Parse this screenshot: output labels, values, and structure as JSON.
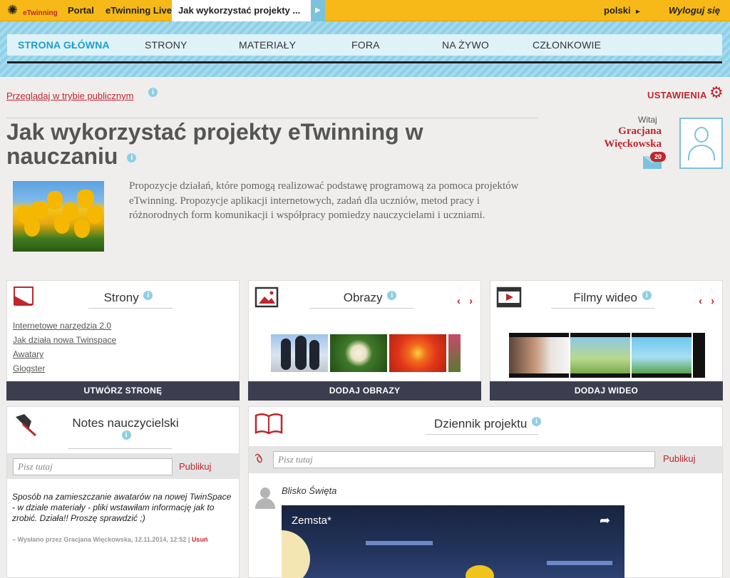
{
  "topbar": {
    "logo_text": "eTwinning",
    "nav": [
      "Portal",
      "eTwinning Live"
    ],
    "active_tab": "Jak wykorzystać projekty ...",
    "language": "polski",
    "language_arrow": "▸",
    "logout": "Wyloguj się"
  },
  "mainnav": {
    "items": [
      "STRONA GŁÓWNA",
      "STRONY",
      "MATERIAŁY",
      "FORA",
      "NA ŻYWO",
      "CZŁONKOWIE"
    ]
  },
  "header": {
    "browse_public": "Przeglądaj w trybie publicznym",
    "settings": "USTAWIENIA",
    "title": "Jak wykorzystać projekty eTwinning w nauczaniu",
    "description": "Propozycje działań, które pomogą realizować podstawę programową za pomoca projektów eTwinning. Propozycje aplikacji internetowych, zadań dla uczniów, metod pracy i różnorodnych form komunikacji i współpracy pomiedzy nauczycielami i uczniami."
  },
  "user": {
    "welcome": "Witaj",
    "name": "Gracjana Więckowska",
    "messages": "20"
  },
  "cards": {
    "pages": {
      "title": "Strony",
      "links": [
        "Internetowe narzędzia 2.0",
        "Jak działa nowa Twinspace",
        "Awatary",
        "Glogster"
      ],
      "button": "UTWÓRZ STRONĘ"
    },
    "images": {
      "title": "Obrazy",
      "button": "DODAJ OBRAZY"
    },
    "videos": {
      "title": "Filmy wideo",
      "button": "DODAJ WIDEO"
    },
    "notes": {
      "title": "Notes nauczycielski",
      "placeholder": "Pisz tutaj",
      "publish": "Publikuj",
      "post_text": "Sposób na zamieszczanie awatarów na nowej TwinSpace - w dziale materiały - pliki wstawiłam informację jak to zrobić. Działa!! Proszę sprawdzić ;)",
      "post_meta": "– Wysłano przez Gracjana Więckowska, 12.11.2014, 12:52 |",
      "delete": "Usuń"
    },
    "journal": {
      "title": "Dziennik projektu",
      "placeholder": "Pisz tutaj",
      "publish": "Publikuj",
      "post_user": "Blisko Święta",
      "video_title": "Zemsta*"
    }
  },
  "icons": {
    "info": "i",
    "arrows": "‹ ›",
    "share": "➦",
    "gear": "⚙",
    "paperclip": "📎"
  },
  "colors": {
    "accent": "#c0262d",
    "topbar": "#f6b917",
    "nav_active": "#1a9fd0",
    "button": "#3c3e50"
  }
}
